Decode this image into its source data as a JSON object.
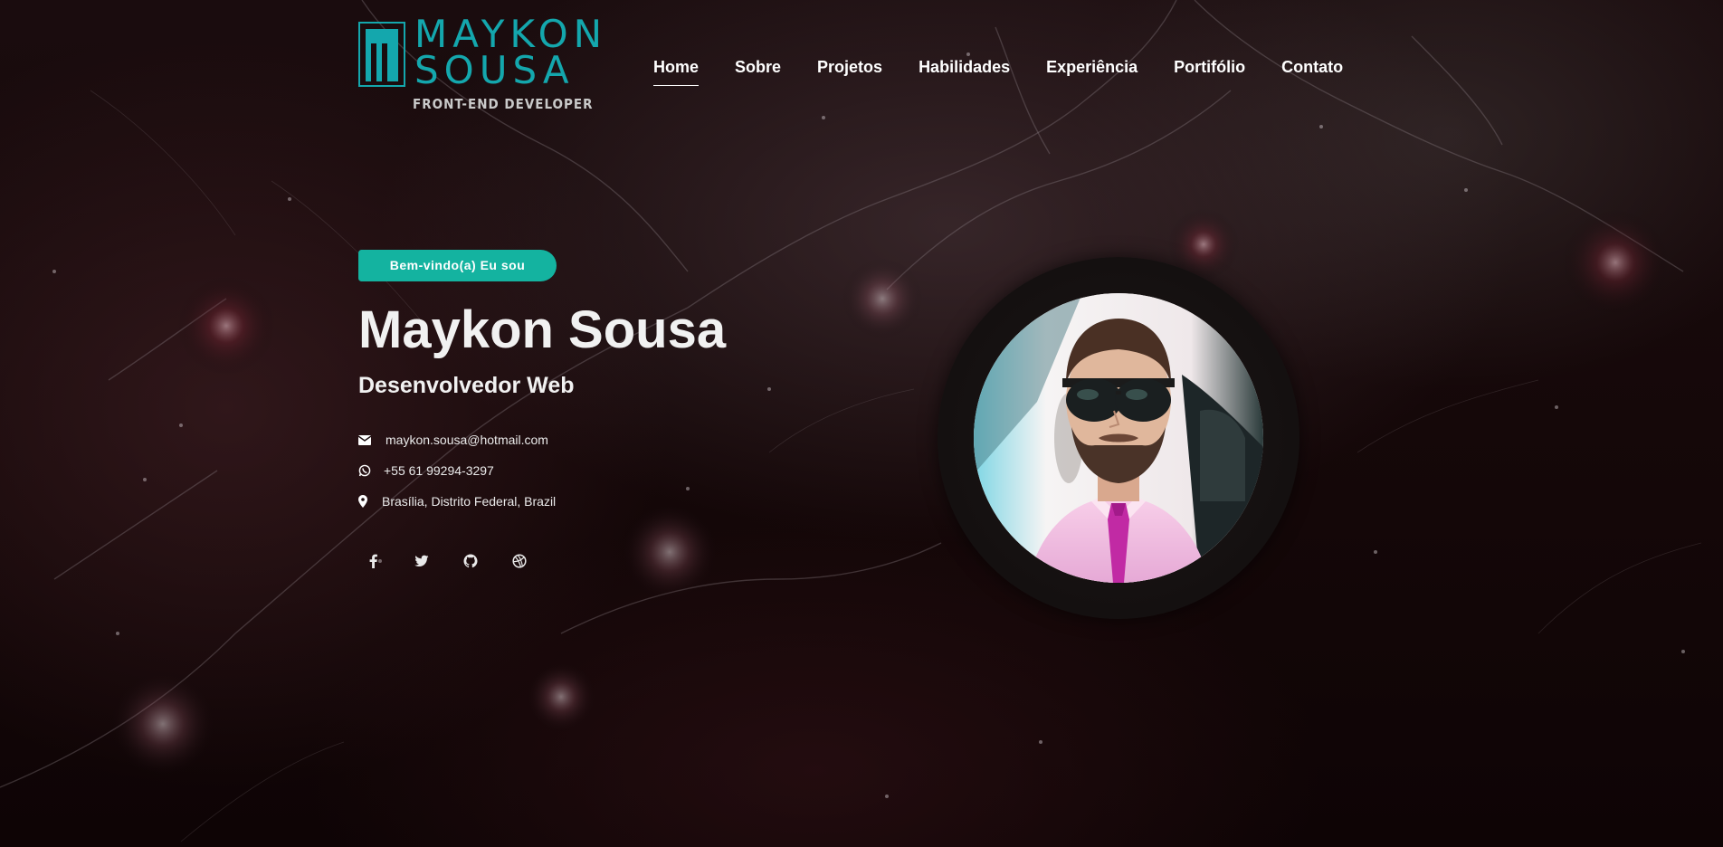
{
  "logo": {
    "name_line1": "MAYKON",
    "name_line2": "SOUSA",
    "tagline": "FRONT-END DEVELOPER",
    "accent_color": "#14a7ad"
  },
  "nav": {
    "items": [
      {
        "label": "Home",
        "active": true
      },
      {
        "label": "Sobre"
      },
      {
        "label": "Projetos"
      },
      {
        "label": "Habilidades"
      },
      {
        "label": "Experiência"
      },
      {
        "label": "Portifólio"
      },
      {
        "label": "Contato"
      }
    ]
  },
  "hero": {
    "badge": "Bem-vindo(a) Eu sou",
    "badge_color": "#14b3a0",
    "name": "Maykon Sousa",
    "role": "Desenvolvedor Web",
    "contacts": {
      "email": {
        "icon": "envelope-icon",
        "text": "maykon.sousa@hotmail.com"
      },
      "phone": {
        "icon": "whatsapp-icon",
        "text": "+55 61 99294-3297"
      },
      "location": {
        "icon": "map-marker-icon",
        "text": "Brasília, Distrito Federal, Brazil"
      }
    },
    "socials": [
      "facebook-icon",
      "twitter-icon",
      "github-icon",
      "dribbble-icon"
    ]
  },
  "avatar": {
    "icon": "profile-photo"
  }
}
